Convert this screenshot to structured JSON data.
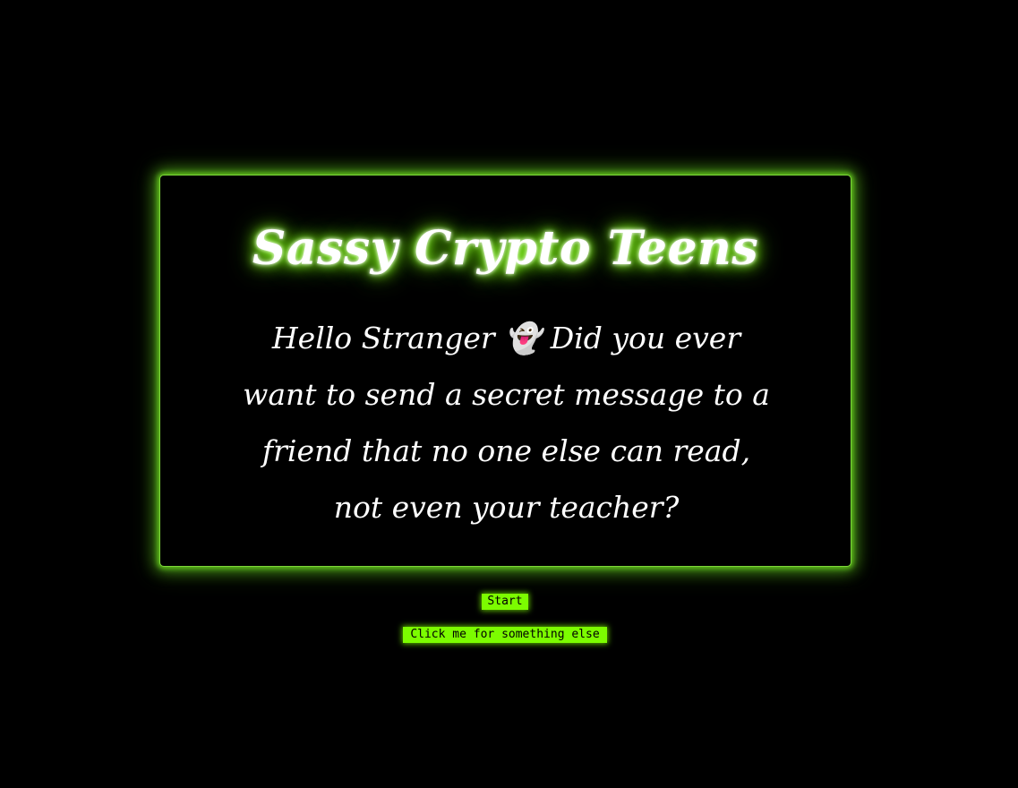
{
  "card": {
    "title": "Sassy Crypto Teens",
    "intro": "Hello Stranger 👻 Did you ever want to send a secret message to a friend that no one else can read, not even your teacher?"
  },
  "buttons": {
    "start_label": "Start",
    "something_else_label": "Click me for something else"
  },
  "colors": {
    "background": "#000000",
    "accent": "#7cfc00",
    "text": "#ffffff"
  }
}
